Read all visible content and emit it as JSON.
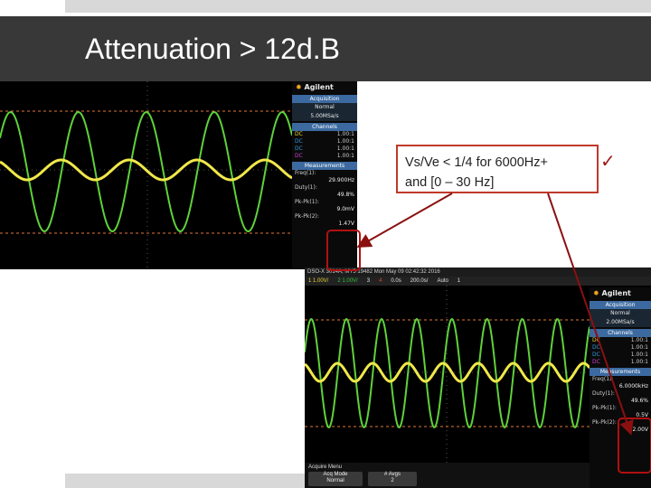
{
  "slide": {
    "title": "Attenuation > 12d.B"
  },
  "callout": {
    "line1": "Vs/Ve < 1/4  for 6000Hz+",
    "line2": "and [0 – 30 Hz]",
    "check_mark": "✓"
  },
  "scope_top": {
    "logo": "Agilent",
    "acquisition": {
      "header": "Acquisition",
      "mode": "Normal",
      "rate": "5.00MSa/s"
    },
    "channels": {
      "header": "Channels",
      "rows": [
        {
          "coupling": "DC",
          "value": "1.00:1"
        },
        {
          "coupling": "DC",
          "value": "1.00:1"
        },
        {
          "coupling": "DC",
          "value": "1.00:1"
        },
        {
          "coupling": "DC",
          "value": "1.00:1"
        }
      ]
    },
    "measurements": {
      "header": "Measurements",
      "freq_label": "Freq(1):",
      "freq_value": "29.900Hz",
      "duty_label": "Duty(1):",
      "duty_value": "49.8%",
      "pkpk1_label": "Pk-Pk(1):",
      "pkpk1_value": "9.0mV",
      "pkpk2_label": "Pk-Pk(2):",
      "pkpk2_value": "1.47V"
    }
  },
  "scope_bottom": {
    "info": "DSO-X 3014A, MY5 19482 Mon May 09 02:42:32 2016",
    "toolbar": [
      "1  1.00V/",
      "2  1.00V/",
      "3",
      "4",
      "0.0s",
      "200.0s/",
      "Auto",
      "1"
    ],
    "logo": "Agilent",
    "acquisition": {
      "header": "Acquisition",
      "mode": "Normal",
      "rate": "2.00MSa/s"
    },
    "channels": {
      "header": "Channels",
      "rows": [
        {
          "coupling": "DC",
          "value": "1.00:1"
        },
        {
          "coupling": "DC",
          "value": "1.00:1"
        },
        {
          "coupling": "DC",
          "value": "1.00:1"
        },
        {
          "coupling": "DC",
          "value": "1.00:1"
        }
      ]
    },
    "measurements": {
      "header": "Measurements",
      "freq_label": "Freq(1):",
      "freq_value": "6.0000kHz",
      "duty_label": "Duty(1):",
      "duty_value": "49.6%",
      "pkpk1_label": "Pk-Pk(1):",
      "pkpk1_value": "0.5V",
      "pkpk2_label": "Pk-Pk(2):",
      "pkpk2_value": "2.00V"
    },
    "menu": {
      "title": "Acquire Menu",
      "softkeys": [
        {
          "label": "Acq Mode",
          "value": "Normal"
        },
        {
          "label": "# Avgs",
          "value": "2"
        }
      ]
    }
  },
  "colors": {
    "title_bar": "#383838",
    "callout_border": "#c0392b",
    "arrow": "#8b1010",
    "trace_green": "#5fd13a",
    "trace_yellow": "#f0e84a",
    "cursor_orange": "#e07838"
  },
  "icons": [
    "agilent-logo-icon",
    "check-mark-icon",
    "arrow-icon"
  ]
}
